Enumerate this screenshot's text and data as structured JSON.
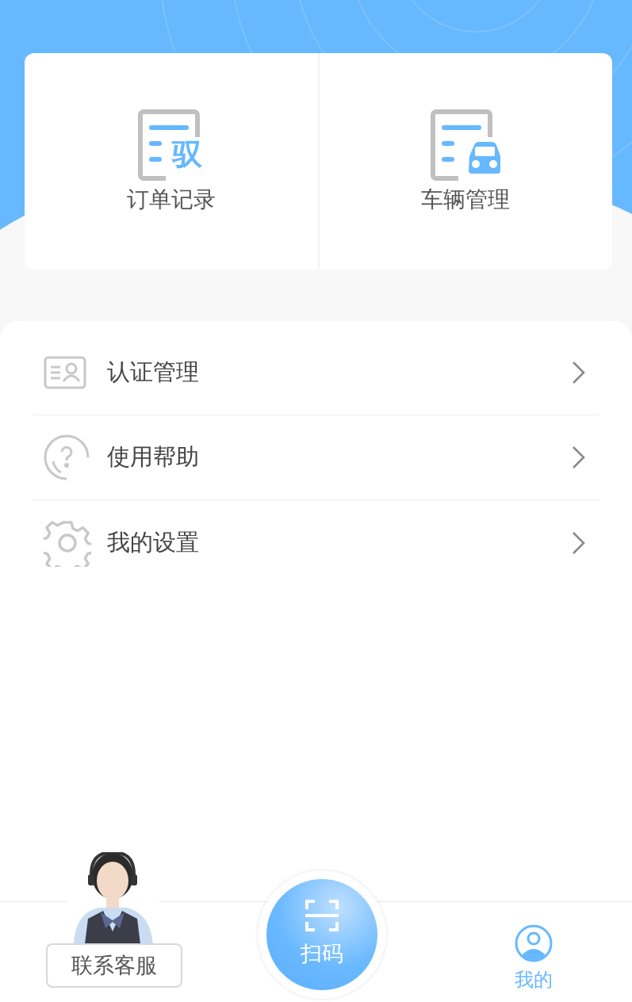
{
  "quick_cards": [
    {
      "kind": "orders",
      "icon_glyph": "驭",
      "label": "订单记录"
    },
    {
      "kind": "vehicles",
      "label": "车辆管理"
    }
  ],
  "menu": [
    {
      "kind": "certificate",
      "label": "认证管理"
    },
    {
      "kind": "help",
      "label": "使用帮助"
    },
    {
      "kind": "settings",
      "label": "我的设置"
    }
  ],
  "customer_service": {
    "label": "联系客服"
  },
  "scan_button": {
    "label": "扫码"
  },
  "tabs": [
    {
      "label": "我的",
      "selected": true
    }
  ]
}
